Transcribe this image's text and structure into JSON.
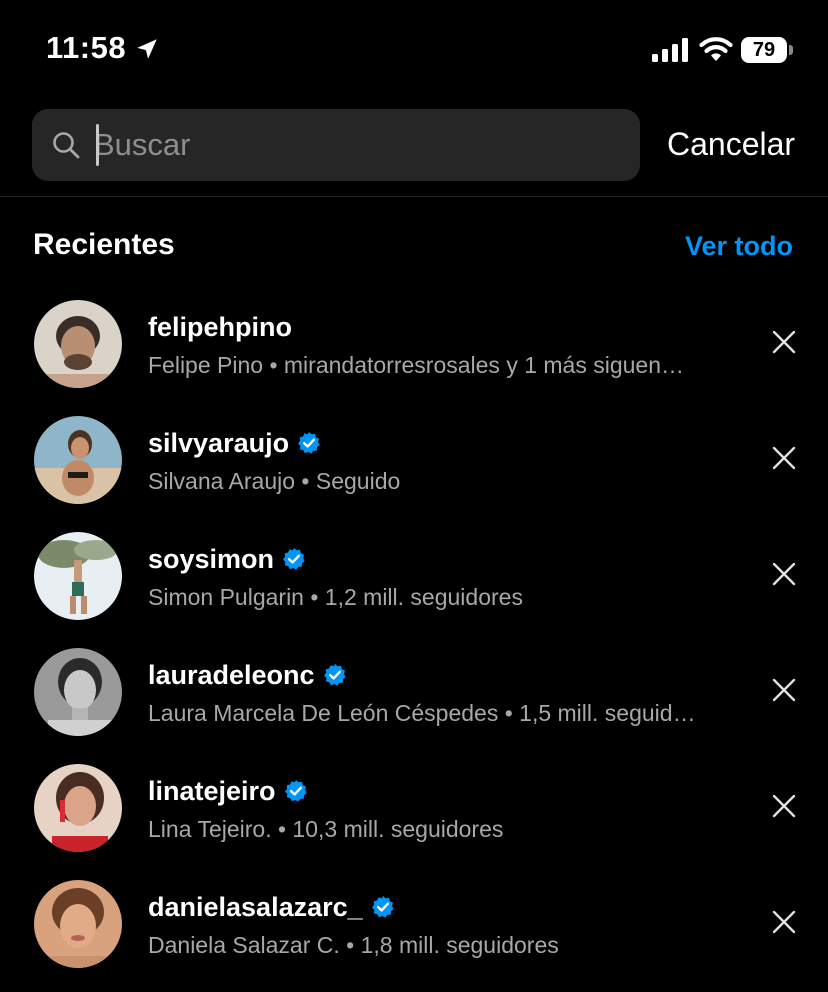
{
  "status_bar": {
    "time": "11:58",
    "battery": "79",
    "icons": [
      "location-arrow-icon",
      "cellular-signal-icon",
      "wifi-icon",
      "battery-icon"
    ]
  },
  "search": {
    "placeholder": "Buscar",
    "value": "",
    "cancel_label": "Cancelar"
  },
  "recents": {
    "title": "Recientes",
    "see_all_label": "Ver todo",
    "items": [
      {
        "username": "felipehpino",
        "verified": false,
        "subtitle": "Felipe Pino • mirandatorresrosales y 1 más siguen…"
      },
      {
        "username": "silvyaraujo",
        "verified": true,
        "subtitle": "Silvana Araujo • Seguido"
      },
      {
        "username": "soysimon",
        "verified": true,
        "subtitle": "Simon Pulgarin • 1,2 mill. seguidores"
      },
      {
        "username": "lauradeleonc",
        "verified": true,
        "subtitle": "Laura Marcela De León Céspedes • 1,5 mill. seguid…"
      },
      {
        "username": "linatejeiro",
        "verified": true,
        "subtitle": "Lina Tejeiro. • 10,3 mill. seguidores"
      },
      {
        "username": "danielasalazarc_",
        "verified": true,
        "subtitle": "Daniela Salazar C. • 1,8 mill. seguidores"
      }
    ]
  },
  "colors": {
    "background": "#000000",
    "search_field": "#262626",
    "accent_blue": "#0095f6",
    "secondary_text": "#a8a8a8"
  }
}
